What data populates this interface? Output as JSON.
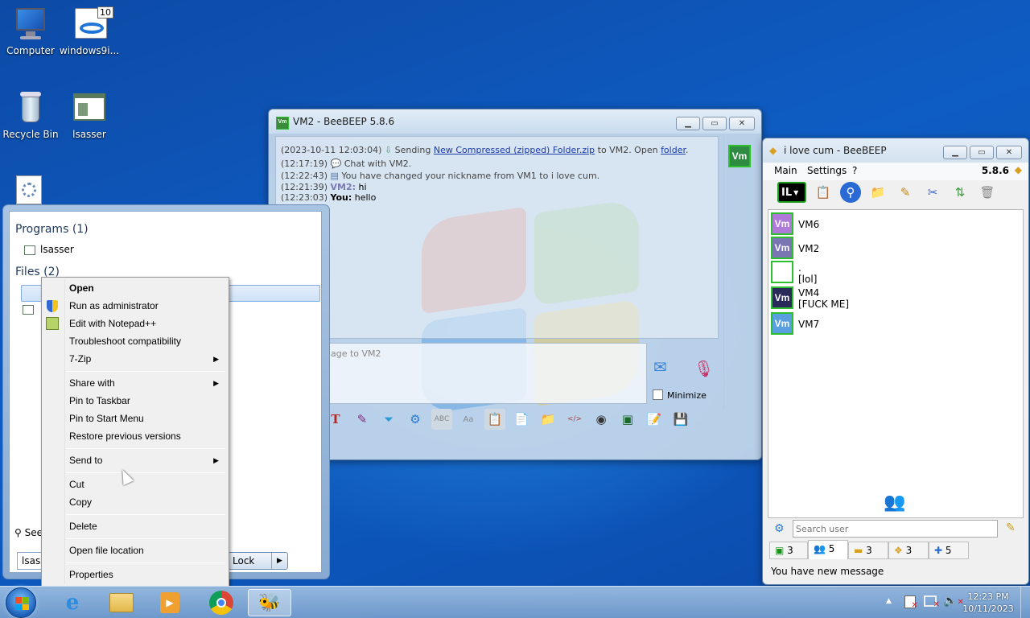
{
  "desktop": {
    "icons": [
      {
        "label": "Computer",
        "icon": "computer-icon"
      },
      {
        "label": "windows9i...",
        "icon": "installer-icon",
        "badge": "10"
      },
      {
        "label": "Recycle Bin",
        "icon": "recycle-bin-icon"
      },
      {
        "label": "lsasser",
        "icon": "program-icon"
      }
    ]
  },
  "chat_window": {
    "title": "VM2 - BeeBEEP 5.8.6",
    "messages": [
      {
        "time": "(2023-10-11 12:03:04)",
        "pre": "Sending ",
        "link": "New Compressed (zipped) Folder.zip",
        "mid": " to VM2. Open ",
        "link2": "folder",
        "post": "."
      },
      {
        "time": "(12:17:19)",
        "text": "Chat with VM2."
      },
      {
        "time": "(12:22:43)",
        "text": "You have changed your nickname from VM1 to i love cum."
      },
      {
        "time": "(12:21:39)",
        "sender": "VM2:",
        "text": "hi"
      },
      {
        "time": "(12:23:03)",
        "sender": "You:",
        "text": "hello"
      }
    ],
    "input_placeholder": "age to VM2",
    "minimize_label": "Minimize",
    "avatar": "Vm"
  },
  "beebeep": {
    "title": "i love cum - BeeBEEP",
    "menu": [
      "Main",
      "Settings",
      "?"
    ],
    "version": "5.8.6",
    "users": [
      {
        "avatar": "Vm",
        "name": "VM6",
        "status": "",
        "color": "#b07ad8"
      },
      {
        "avatar": "Vm",
        "name": "VM2",
        "status": "",
        "color": "#7a76b4"
      },
      {
        "avatar": "",
        "name": ".",
        "status": "[lol]",
        "color": "#ffffff"
      },
      {
        "avatar": "Vm",
        "name": "VM4",
        "status": "[FUCK ME]",
        "color": "#2a2a5a"
      },
      {
        "avatar": "Vm",
        "name": "VM7",
        "status": "",
        "color": "#5aa0e0"
      }
    ],
    "search_placeholder": "Search user",
    "tabs": [
      "3",
      "5",
      "3",
      "3",
      "5"
    ],
    "status": "You have new message"
  },
  "start_menu": {
    "programs_header": "Programs (1)",
    "program_item": "lsasser",
    "files_header": "Files (2)",
    "see_more": "See",
    "search_value": "lsass",
    "lock_label": "Lock"
  },
  "context_menu": {
    "items": [
      "Open",
      "Run as administrator",
      "Edit with Notepad++",
      "Troubleshoot compatibility",
      "7-Zip",
      "Share with",
      "Pin to Taskbar",
      "Pin to Start Menu",
      "Restore previous versions",
      "Send to",
      "Cut",
      "Copy",
      "Delete",
      "Open file location",
      "Properties"
    ]
  },
  "taskbar": {
    "time": "12:23 PM",
    "date": "10/11/2023"
  }
}
